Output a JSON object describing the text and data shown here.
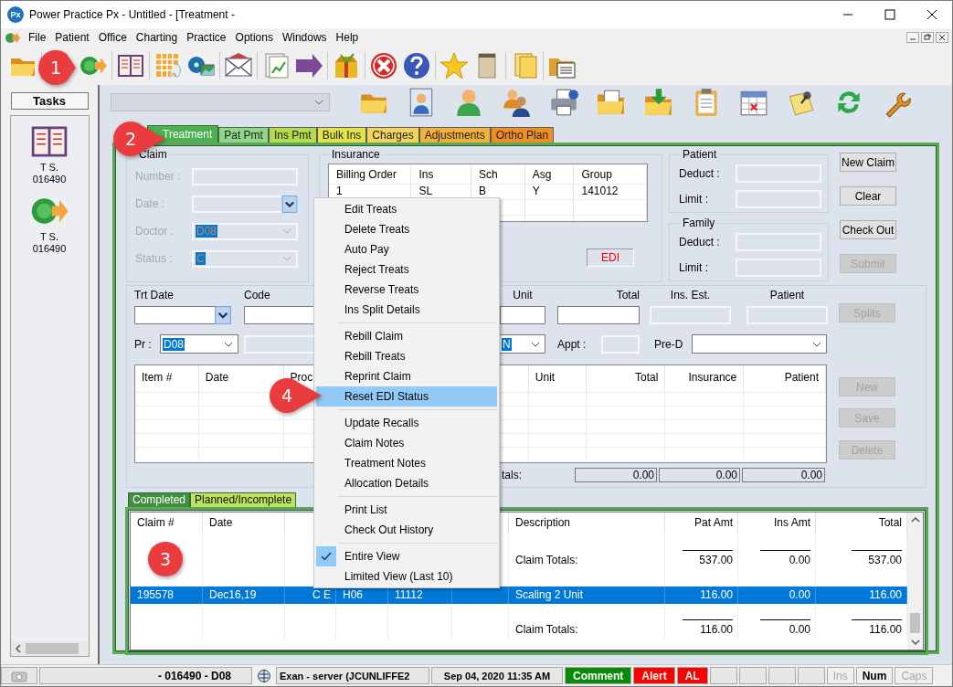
{
  "window": {
    "logo": "Px",
    "title": "Power Practice Px - Untitled - [Treatment -"
  },
  "menu_bar": [
    "File",
    "Patient",
    "Office",
    "Charting",
    "Practice",
    "Options",
    "Windows",
    "Help"
  ],
  "tasks": {
    "title": "Tasks",
    "items": [
      {
        "kind": "book",
        "name": "T S.",
        "number": "016490"
      },
      {
        "kind": "payment",
        "name": "T S.",
        "number": "016490"
      }
    ]
  },
  "tabs": [
    {
      "label": "Treatment",
      "selected": true,
      "color": "#4caf50"
    },
    {
      "label": "Pat Pmt",
      "selected": false,
      "color": "#8fd88a"
    },
    {
      "label": "Ins Pmt",
      "selected": false,
      "color": "#b5db4a"
    },
    {
      "label": "Bulk Ins",
      "selected": false,
      "color": "#e2e24a"
    },
    {
      "label": "Charges",
      "selected": false,
      "color": "#f2d35c"
    },
    {
      "label": "Adjustments",
      "selected": false,
      "color": "#f3b13c"
    },
    {
      "label": "Ortho Plan",
      "selected": false,
      "color": "#ef8f1f"
    }
  ],
  "claim": {
    "title": "Claim",
    "fields": [
      {
        "label": "Number :",
        "kind": "text",
        "disabled": true
      },
      {
        "label": "Date :",
        "kind": "date",
        "disabled": true
      },
      {
        "label": "Doctor :",
        "kind": "combo",
        "value": "D08",
        "disabled": true
      },
      {
        "label": "Status :",
        "kind": "combo",
        "value": "C",
        "disabled": true
      }
    ]
  },
  "insurance": {
    "title": "Insurance",
    "columns": [
      "Billing Order",
      "Ins",
      "Sch",
      "Asg",
      "Group"
    ],
    "rows": [
      [
        "1",
        "SL",
        "B",
        "Y",
        "141012"
      ]
    ],
    "edi_label": "EDI"
  },
  "patient": {
    "title": "Patient",
    "fields": [
      "Deduct :",
      "Limit :"
    ]
  },
  "family": {
    "title": "Family",
    "fields": [
      "Deduct :",
      "Limit :"
    ]
  },
  "claim_buttons": [
    {
      "label": "New Claim",
      "disabled": false
    },
    {
      "label": "Clear",
      "disabled": false
    },
    {
      "label": "Check Out",
      "disabled": false
    },
    {
      "label": "Submit",
      "disabled": true
    }
  ],
  "entry": {
    "trt_date": "Trt Date",
    "code": "Code",
    "unit": "Unit",
    "total": "Total",
    "ins_est": "Ins. Est.",
    "patient": "Patient",
    "provider_label": "Pr :",
    "provider": "D08",
    "column_3": "N",
    "appt": "Appt :",
    "pre_d": "Pre-D"
  },
  "splits_button": {
    "label": "Splits",
    "disabled": true
  },
  "items_table": {
    "columns": [
      "Item #",
      "Date",
      "Proc",
      "Unit",
      "Total",
      "Insurance",
      "Patient"
    ],
    "totals_label": "tals:",
    "totals": [
      "0.00",
      "0.00",
      "0.00"
    ]
  },
  "item_buttons": [
    {
      "label": "New",
      "disabled": true
    },
    {
      "label": "Save",
      "disabled": true
    },
    {
      "label": "Delete",
      "disabled": true
    }
  ],
  "history_tabs": [
    {
      "label": "Completed",
      "selected": true,
      "color": "#3f8f3f"
    },
    {
      "label": "Planned/Incomplete",
      "selected": false,
      "color": "#bde35a"
    }
  ],
  "history_table": {
    "columns": {
      "claim": "Claim #",
      "date": "Date",
      "description": "Description",
      "pat_amt": "Pat Amt",
      "ins_amt": "Ins Amt",
      "total": "Total"
    },
    "rows": [
      {
        "kind": "totals",
        "selected": false,
        "description": "Claim Totals:",
        "pat_amt": "537.00",
        "ins_amt": "0.00",
        "total": "537.00"
      },
      {
        "kind": "claim",
        "selected": true,
        "claim": "195578",
        "date": "Dec16,19",
        "column_3": "C E",
        "column_4": "H06",
        "column_5": "11112",
        "description": "Scaling 2 Unit",
        "pat_amt": "116.00",
        "ins_amt": "0.00",
        "total": "116.00"
      },
      {
        "kind": "totals",
        "selected": false,
        "description": "Claim Totals:",
        "pat_amt": "116.00",
        "ins_amt": "0.00",
        "total": "116.00"
      }
    ]
  },
  "context_menu": {
    "groups": [
      [
        {
          "label": "Edit Treats",
          "highlighted": false,
          "checked": false
        },
        {
          "label": "Delete Treats",
          "highlighted": false,
          "checked": false
        },
        {
          "label": "Auto Pay",
          "highlighted": false,
          "checked": false
        },
        {
          "label": "Reject Treats",
          "highlighted": false,
          "checked": false
        },
        {
          "label": "Reverse Treats",
          "highlighted": false,
          "checked": false
        },
        {
          "label": "Ins Split Details",
          "highlighted": false,
          "checked": false
        }
      ],
      [
        {
          "label": "Rebill Claim",
          "highlighted": false,
          "checked": false
        },
        {
          "label": "Rebill Treats",
          "highlighted": false,
          "checked": false
        },
        {
          "label": "Reprint Claim",
          "highlighted": false,
          "checked": false
        },
        {
          "label": "Reset EDI Status",
          "highlighted": true,
          "checked": false
        }
      ],
      [
        {
          "label": "Update Recalls",
          "highlighted": false,
          "checked": false
        },
        {
          "label": "Claim Notes",
          "highlighted": false,
          "checked": false
        },
        {
          "label": "Treatment Notes",
          "highlighted": false,
          "checked": false
        },
        {
          "label": "Allocation Details",
          "highlighted": false,
          "checked": false
        }
      ],
      [
        {
          "label": "Print List",
          "highlighted": false,
          "checked": false
        },
        {
          "label": "Check Out History",
          "highlighted": false,
          "checked": false
        }
      ],
      [
        {
          "label": "Entire View",
          "highlighted": false,
          "checked": true
        },
        {
          "label": "Limited View (Last 10)",
          "highlighted": false,
          "checked": false
        }
      ]
    ]
  },
  "status_bar": {
    "patient": "- 016490 - D08",
    "user": "Exan - server (JCUNLIFFE2",
    "datetime": "Sep 04, 2020 11:35 AM",
    "flags": [
      {
        "label": "Comment",
        "color": "#0a8a0a"
      },
      {
        "label": "Alert",
        "color": "#ff0000"
      },
      {
        "label": "AL",
        "color": "#ff0000"
      }
    ],
    "keys": [
      {
        "label": "Ins",
        "on": false
      },
      {
        "label": "Num",
        "on": true
      },
      {
        "label": "Caps",
        "on": false
      }
    ]
  },
  "callouts": [
    "1",
    "2",
    "3",
    "4"
  ]
}
